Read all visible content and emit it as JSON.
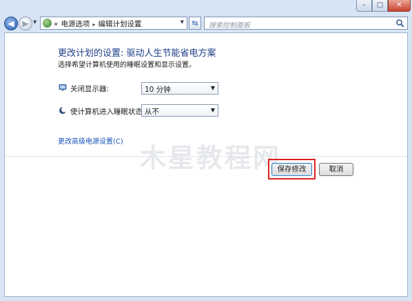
{
  "window": {
    "min_glyph": "–",
    "max_glyph": "□",
    "close_glyph": "✕"
  },
  "nav": {
    "back_glyph": "◀",
    "forward_glyph": "▶",
    "breadcrumb": {
      "prefix": "«",
      "items": [
        "电源选项",
        "编辑计划设置"
      ],
      "separator": "▸"
    },
    "refresh_glyph": "⇆",
    "search_placeholder": "搜索控制面板"
  },
  "main": {
    "title": "更改计划的设置: 驱动人生节能省电方案",
    "description": "选择希望计算机使用的睡眠设置和显示设置。",
    "settings": [
      {
        "label": "关闭显示器:",
        "value": "10 分钟",
        "icon": "monitor-icon"
      },
      {
        "label": "使计算机进入睡眠状态:",
        "value": "从不",
        "icon": "sleep-moon-icon"
      }
    ],
    "advanced_link": "更改高级电源设置(C)",
    "save_button": "保存修改",
    "cancel_button": "取消",
    "watermark": "木星教程网"
  },
  "colors": {
    "title": "#1c3e8a",
    "link": "#1a56b8",
    "highlight": "#e0201c"
  }
}
